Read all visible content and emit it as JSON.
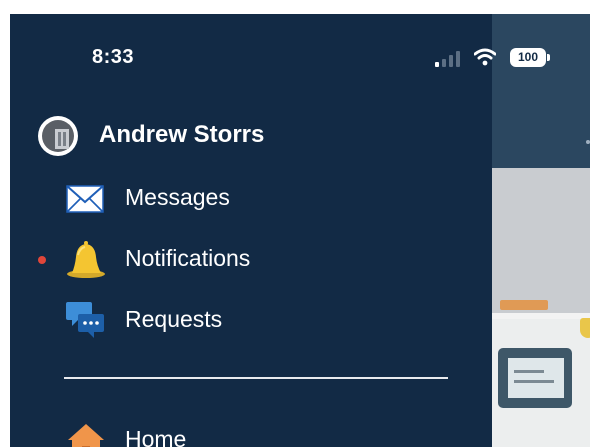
{
  "status_bar": {
    "time": "8:33",
    "battery": "100",
    "icons": [
      "cellular-signal-icon",
      "wifi-icon",
      "battery-icon"
    ]
  },
  "profile": {
    "name": "Andrew Storrs",
    "avatar_icon": "avatar-building-icon"
  },
  "menu": {
    "items": [
      {
        "label": "Messages",
        "icon": "envelope-icon",
        "unread": false
      },
      {
        "label": "Notifications",
        "icon": "bell-icon",
        "unread": true
      },
      {
        "label": "Requests",
        "icon": "chat-bubbles-icon",
        "unread": false
      },
      {
        "label": "Home",
        "icon": "home-icon",
        "unread": false
      }
    ]
  },
  "colors": {
    "drawer_background": "#122a45",
    "unread_dot": "#e0463a",
    "bell": "#f4c531",
    "home": "#f0954a",
    "text": "#ffffff"
  }
}
